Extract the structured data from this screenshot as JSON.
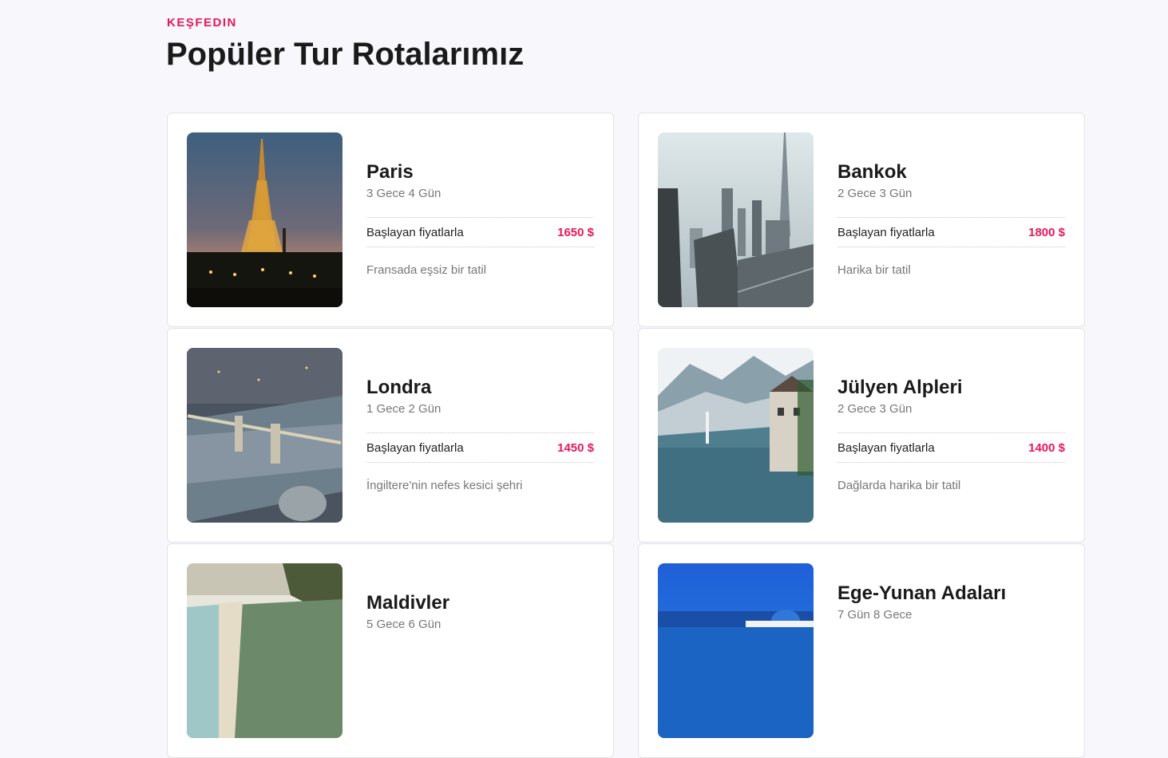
{
  "section": {
    "eyebrow": "KEŞFEDIN",
    "title": "Popüler Tur Rotalarımız"
  },
  "tours": [
    {
      "name": "Paris",
      "duration": "3 Gece 4 Gün",
      "price_label": "Başlayan fiyatlarla",
      "price": "1650 $",
      "description": "Fransada eşsiz bir tatil",
      "image": "eiffel-tower-photo"
    },
    {
      "name": "Bankok",
      "duration": "2 Gece 3 Gün",
      "price_label": "Başlayan fiyatlarla",
      "price": "1800 $",
      "description": "Harika bir tatil",
      "image": "city-skyline-photo"
    },
    {
      "name": "Londra",
      "duration": "1 Gece 2 Gün",
      "price_label": "Başlayan fiyatlarla",
      "price": "1450 $",
      "description": "İngiltere'nin nefes kesici şehri",
      "image": "tower-bridge-photo"
    },
    {
      "name": "Jülyen Alpleri",
      "duration": "2 Gece 3 Gün",
      "price_label": "Başlayan fiyatlarla",
      "price": "1400 $",
      "description": "Dağlarda harika bir tatil",
      "image": "alpine-lake-village-photo"
    },
    {
      "name": "Maldivler",
      "duration": "5 Gece 6 Gün",
      "price_label": "",
      "price": "",
      "description": "",
      "image": "tropical-beach-photo"
    },
    {
      "name": "Ege-Yunan Adaları",
      "duration": "7 Gün 8 Gece",
      "price_label": "",
      "price": "",
      "description": "",
      "image": "greek-island-photo"
    }
  ],
  "colors": {
    "accent": "#e8185a",
    "background": "#f7f7fc",
    "card": "#ffffff",
    "muted_text": "#777777"
  }
}
